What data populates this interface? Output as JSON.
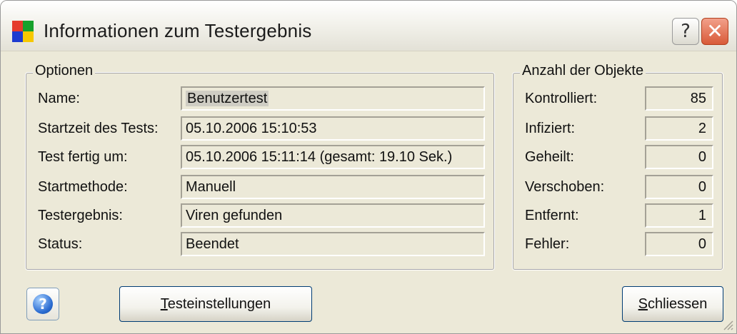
{
  "window": {
    "title": "Informationen zum Testergebnis",
    "help_glyph": "?",
    "close_glyph": "✕",
    "icon_colors": [
      "#e53b2c",
      "#16a12b",
      "#1d3bd0",
      "#f6c800"
    ]
  },
  "options": {
    "group_title": "Optionen",
    "rows": [
      {
        "label": "Name:",
        "value": "Benutzertest"
      },
      {
        "label": "Startzeit des Tests:",
        "value": "05.10.2006 15:10:53"
      },
      {
        "label": "Test fertig um:",
        "value": "05.10.2006 15:11:14  (gesamt: 19.10 Sek.)"
      },
      {
        "label": "Startmethode:",
        "value": "Manuell"
      },
      {
        "label": "Testergebnis:",
        "value": "Viren gefunden"
      },
      {
        "label": "Status:",
        "value": "Beendet"
      }
    ]
  },
  "objects": {
    "group_title": "Anzahl der Objekte",
    "rows": [
      {
        "label": "Kontrolliert:",
        "value": "85"
      },
      {
        "label": "Infiziert:",
        "value": "2"
      },
      {
        "label": "Geheilt:",
        "value": "0"
      },
      {
        "label": "Verschoben:",
        "value": "0"
      },
      {
        "label": "Entfernt:",
        "value": "1"
      },
      {
        "label": "Fehler:",
        "value": "0"
      }
    ]
  },
  "buttons": {
    "help_glyph": "?",
    "settings_mnemonic": "T",
    "settings_rest": "esteinstellungen",
    "close_mnemonic": "S",
    "close_rest": "chliessen"
  }
}
